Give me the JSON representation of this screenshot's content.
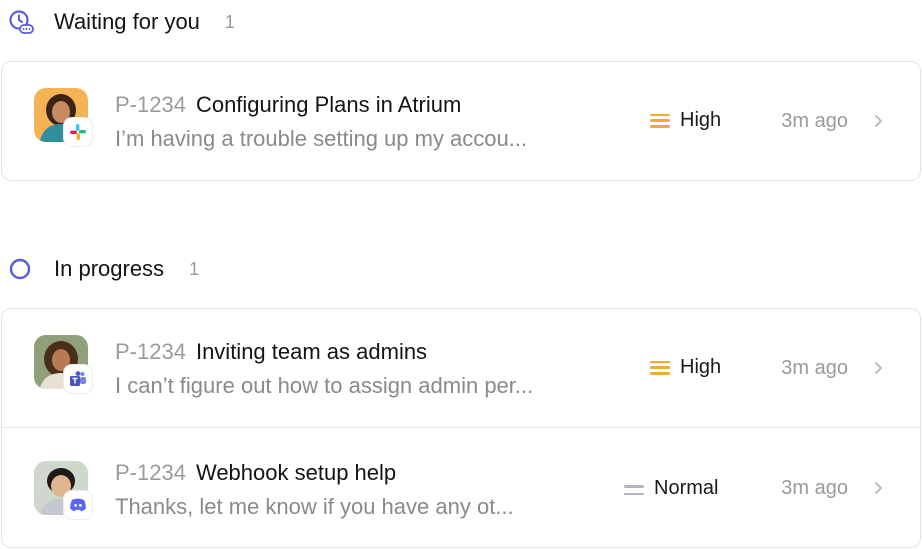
{
  "sections": [
    {
      "title": "Waiting for you",
      "count": "1",
      "icon": "clock-wait-icon",
      "accent": "#5b5fd6",
      "tickets": [
        {
          "id": "P-1234",
          "title": "Configuring Plans in Atrium",
          "preview": "I’m having a trouble setting up my accou...",
          "priority": "High",
          "priority_color": "#f2a93b",
          "time": "3m ago",
          "channel_icon": "slack-icon"
        }
      ]
    },
    {
      "title": "In progress",
      "count": "1",
      "icon": "in-progress-circle-icon",
      "accent": "#5b5fd6",
      "tickets": [
        {
          "id": "P-1234",
          "title": "Inviting team as admins",
          "preview": "I can’t figure out how to assign admin per...",
          "priority": "High",
          "priority_color": "#f2a93b",
          "time": "3m ago",
          "channel_icon": "microsoft-teams-icon"
        },
        {
          "id": "P-1234",
          "title": "Webhook setup help",
          "preview": "Thanks, let me know if you have any ot...",
          "priority": "Normal",
          "priority_color": "#b4b4c2",
          "time": "3m ago",
          "channel_icon": "discord-icon"
        }
      ]
    }
  ]
}
